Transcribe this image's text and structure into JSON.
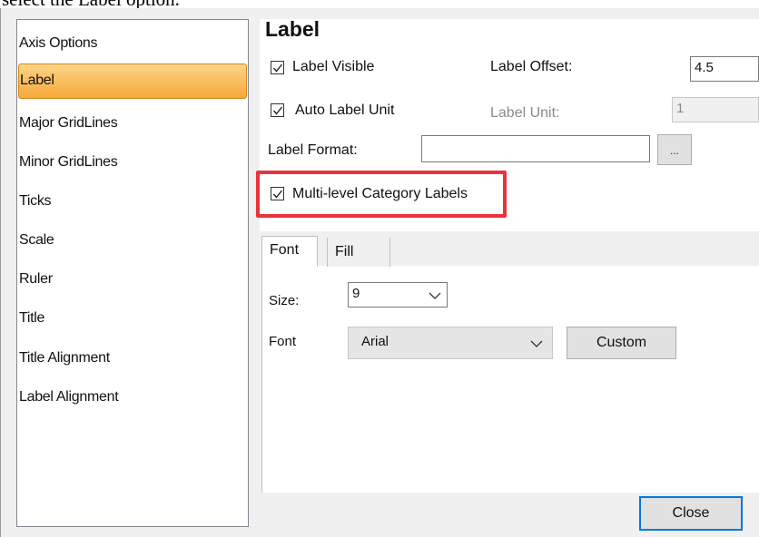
{
  "caption": "select the Label option.",
  "sidebar": {
    "items": [
      {
        "label": "Axis Options"
      },
      {
        "label": "Label"
      },
      {
        "label": "Major GridLines"
      },
      {
        "label": "Minor GridLines"
      },
      {
        "label": "Ticks"
      },
      {
        "label": "Scale"
      },
      {
        "label": "Ruler"
      },
      {
        "label": "Title"
      },
      {
        "label": "Title Alignment"
      },
      {
        "label": "Label Alignment"
      }
    ],
    "selected": "Label"
  },
  "panel": {
    "title": "Label",
    "label_visible": {
      "label": "Label Visible",
      "checked": true
    },
    "label_offset": {
      "label": "Label Offset:",
      "value": "4.5"
    },
    "auto_label_unit": {
      "label": "Auto Label Unit",
      "checked": true
    },
    "label_unit": {
      "label": "Label Unit:",
      "value": "1"
    },
    "label_format": {
      "label": "Label Format:",
      "value": "",
      "browse_label": "..."
    },
    "multi_level": {
      "label": "Multi-level Category Labels",
      "checked": true
    }
  },
  "tabs": [
    {
      "label": "Font",
      "active": true
    },
    {
      "label": "Fill",
      "active": false
    }
  ],
  "font_tab": {
    "size_label": "Size:",
    "size_value": "9",
    "font_label": "Font",
    "font_value": "Arial",
    "custom_label": "Custom"
  },
  "footer": {
    "close_label": "Close"
  },
  "colors": {
    "selection_top": "#fcd387",
    "selection_bottom": "#f5a93a",
    "highlight": "#e8333b",
    "focus": "#0078d7"
  }
}
